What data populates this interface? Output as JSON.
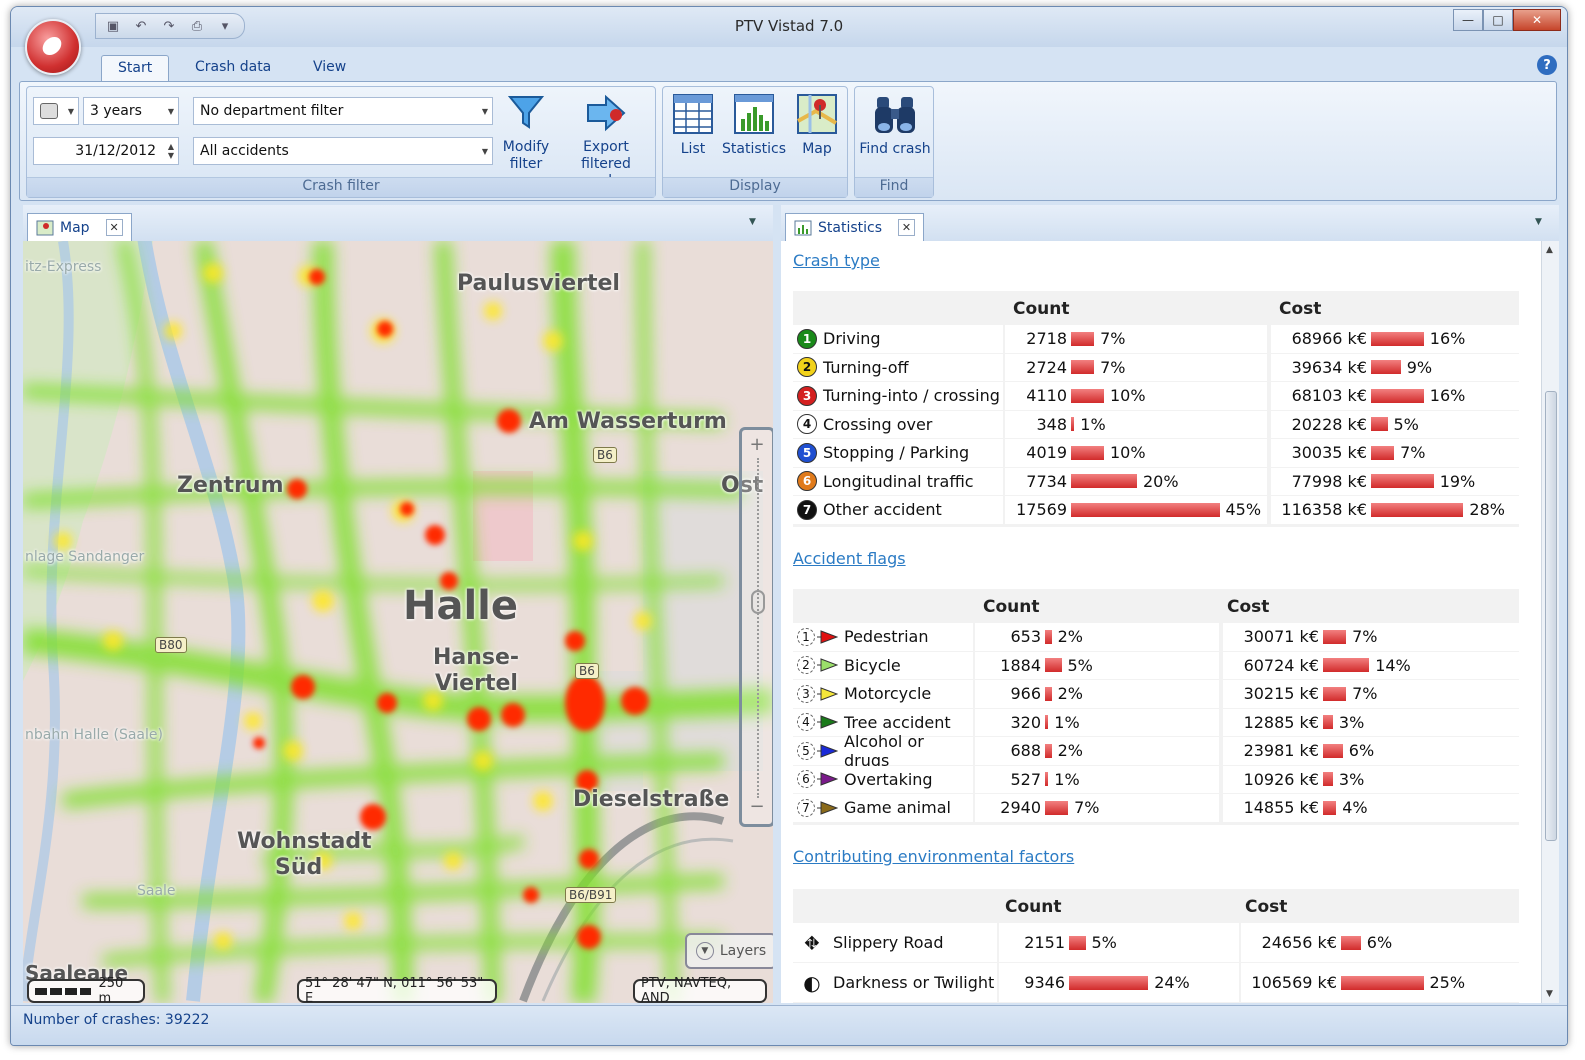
{
  "app": {
    "title": "PTV Vistad 7.0"
  },
  "ribbon": {
    "tabs": [
      "Start",
      "Crash data",
      "View"
    ],
    "crash_filter": {
      "period": "3 years",
      "date": "31/12/2012",
      "department": "No department filter",
      "accidents": "All accidents",
      "group_label": "Crash filter"
    },
    "buttons": {
      "modify_filter": "Modify filter",
      "export": "Export filtered crashes",
      "list": "List",
      "statistics": "Statistics",
      "map": "Map",
      "find_crash": "Find crash"
    },
    "group_display": "Display",
    "group_find": "Find"
  },
  "map_panel": {
    "tab": "Map",
    "labels": {
      "paulusviertel": "Paulusviertel",
      "am_wasserturm": "Am Wasserturm",
      "zentrum": "Zentrum",
      "ost": "Ost",
      "halle": "Halle",
      "hanse": "Hanse-",
      "viertel": "Viertel",
      "dieselstrasse": "Dieselstraße",
      "wohnstadt": "Wohnstadt",
      "sued": "Süd",
      "express": "itz-Express",
      "sandanger": "nlage Sandanger",
      "bahn": "nbahn Halle (Saale)",
      "saale": "Saale",
      "saaleaue": "Saaleaue"
    },
    "roads": {
      "b6a": "B6",
      "b6b": "B6",
      "b80": "B80",
      "b6b91": "B6/B91"
    },
    "zoom": {
      "plus": "+",
      "minus": "−"
    },
    "scale": "250 m",
    "coords": "51° 28' 47\" N, 011° 56' 53\" E",
    "attribution": "PTV, NAVTEQ, AND",
    "layers": "Layers"
  },
  "stats_panel": {
    "tab": "Statistics",
    "crash_type": {
      "title": "Crash type",
      "count_header": "Count",
      "cost_header": "Cost",
      "rows": [
        {
          "badge": "1",
          "color": "#1a8a1a",
          "label": "Driving",
          "count": "2718",
          "count_pct": "7%",
          "count_frac": 0.07,
          "cost": "68966 k€",
          "cost_pct": "16%",
          "cost_frac": 0.16
        },
        {
          "badge": "2",
          "color": "#f2d21a",
          "label": "Turning-off",
          "count": "2724",
          "count_pct": "7%",
          "count_frac": 0.07,
          "cost": "39634 k€",
          "cost_pct": "9%",
          "cost_frac": 0.09
        },
        {
          "badge": "3",
          "color": "#d42020",
          "label": "Turning-into / crossing",
          "count": "4110",
          "count_pct": "10%",
          "count_frac": 0.1,
          "cost": "68103 k€",
          "cost_pct": "16%",
          "cost_frac": 0.16
        },
        {
          "badge": "4",
          "color": "#ffffff",
          "label": "Crossing over",
          "count": "348",
          "count_pct": "1%",
          "count_frac": 0.01,
          "cost": "20228 k€",
          "cost_pct": "5%",
          "cost_frac": 0.05
        },
        {
          "badge": "5",
          "color": "#1f4fd1",
          "label": "Stopping / Parking",
          "count": "4019",
          "count_pct": "10%",
          "count_frac": 0.1,
          "cost": "30035 k€",
          "cost_pct": "7%",
          "cost_frac": 0.07
        },
        {
          "badge": "6",
          "color": "#e07a1a",
          "label": "Longitudinal traffic",
          "count": "7734",
          "count_pct": "20%",
          "count_frac": 0.2,
          "cost": "77998 k€",
          "cost_pct": "19%",
          "cost_frac": 0.19
        },
        {
          "badge": "7",
          "color": "#111111",
          "label": "Other accident",
          "count": "17569",
          "count_pct": "45%",
          "count_frac": 0.45,
          "cost": "116358 k€",
          "cost_pct": "28%",
          "cost_frac": 0.28
        }
      ]
    },
    "accident_flags": {
      "title": "Accident flags",
      "count_header": "Count",
      "cost_header": "Cost",
      "rows": [
        {
          "num": "1",
          "color": "#e01010",
          "label": "Pedestrian",
          "count": "653",
          "count_pct": "2%",
          "count_frac": 0.02,
          "cost": "30071 k€",
          "cost_pct": "7%",
          "cost_frac": 0.07
        },
        {
          "num": "2",
          "color": "#9be06a",
          "label": "Bicycle",
          "count": "1884",
          "count_pct": "5%",
          "count_frac": 0.05,
          "cost": "60724 k€",
          "cost_pct": "14%",
          "cost_frac": 0.14
        },
        {
          "num": "3",
          "color": "#f5e63a",
          "label": "Motorcycle",
          "count": "966",
          "count_pct": "2%",
          "count_frac": 0.02,
          "cost": "30215 k€",
          "cost_pct": "7%",
          "cost_frac": 0.07
        },
        {
          "num": "4",
          "color": "#1a7a1a",
          "label": "Tree accident",
          "count": "320",
          "count_pct": "1%",
          "count_frac": 0.01,
          "cost": "12885 k€",
          "cost_pct": "3%",
          "cost_frac": 0.03
        },
        {
          "num": "5",
          "color": "#1a2ad8",
          "label": "Alcohol or drugs",
          "count": "688",
          "count_pct": "2%",
          "count_frac": 0.02,
          "cost": "23981 k€",
          "cost_pct": "6%",
          "cost_frac": 0.06
        },
        {
          "num": "6",
          "color": "#7a1a8a",
          "label": "Overtaking",
          "count": "527",
          "count_pct": "1%",
          "count_frac": 0.01,
          "cost": "10926 k€",
          "cost_pct": "3%",
          "cost_frac": 0.03
        },
        {
          "num": "7",
          "color": "#8a6a1a",
          "label": "Game animal",
          "count": "2940",
          "count_pct": "7%",
          "count_frac": 0.07,
          "cost": "14855 k€",
          "cost_pct": "4%",
          "cost_frac": 0.04
        }
      ]
    },
    "environment": {
      "title": "Contributing environmental factors",
      "count_header": "Count",
      "cost_header": "Cost",
      "rows": [
        {
          "icon": "slippery-road-icon",
          "label": "Slippery Road",
          "count": "2151",
          "count_pct": "5%",
          "count_frac": 0.05,
          "cost": "24656 k€",
          "cost_pct": "6%",
          "cost_frac": 0.06
        },
        {
          "icon": "darkness-icon",
          "label": "Darkness or Twilight",
          "count": "9346",
          "count_pct": "24%",
          "count_frac": 0.24,
          "cost": "106569 k€",
          "cost_pct": "25%",
          "cost_frac": 0.25
        }
      ]
    }
  },
  "statusbar": {
    "text": "Number of crashes: 39222"
  }
}
